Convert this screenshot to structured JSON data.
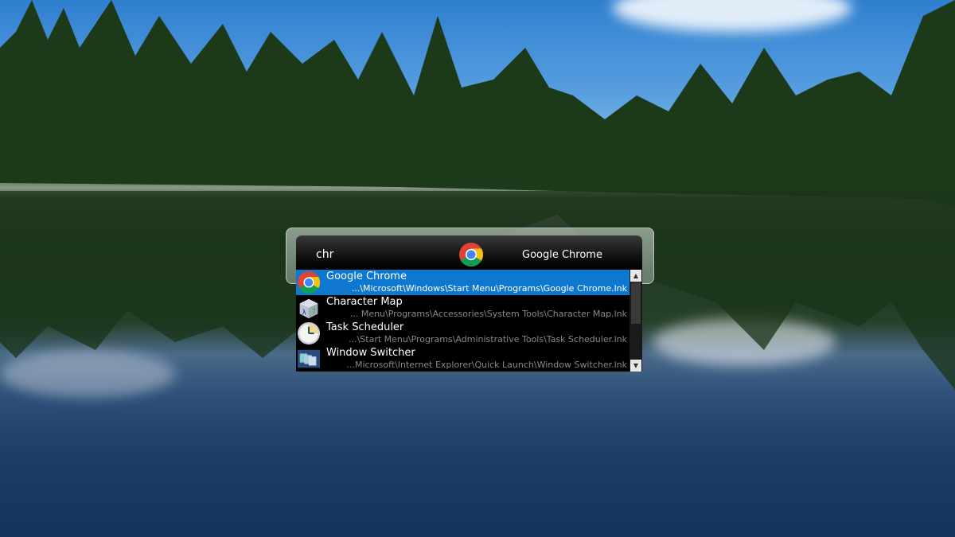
{
  "launcher": {
    "query": "chr",
    "result_label": "Google Chrome",
    "results": [
      {
        "name": "Google Chrome",
        "path": "...\\Microsoft\\Windows\\Start Menu\\Programs\\Google Chrome.lnk",
        "icon": "chrome-icon",
        "selected": true
      },
      {
        "name": "Character Map",
        "path": "... Menu\\Programs\\Accessories\\System Tools\\Character Map.lnk",
        "icon": "character-map-icon",
        "selected": false
      },
      {
        "name": "Task Scheduler",
        "path": "...\\Start Menu\\Programs\\Administrative Tools\\Task Scheduler.lnk",
        "icon": "clock-icon",
        "selected": false
      },
      {
        "name": "Window Switcher",
        "path": "...Microsoft\\Internet Explorer\\Quick Launch\\Window Switcher.lnk",
        "icon": "window-switcher-icon",
        "selected": false
      }
    ],
    "colors": {
      "selection": "#0e78d0",
      "path_text": "#888888"
    }
  }
}
